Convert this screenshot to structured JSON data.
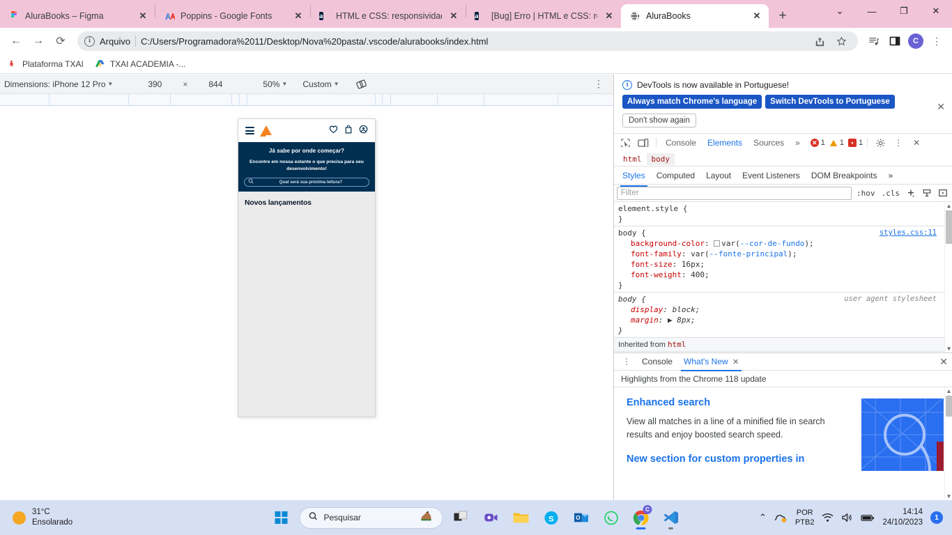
{
  "browser": {
    "tabs": [
      {
        "title": "AluraBooks – Figma",
        "favicon": "figma-icon",
        "active": false
      },
      {
        "title": "Poppins - Google Fonts",
        "favicon": "google-fonts-icon",
        "active": false
      },
      {
        "title": "HTML e CSS: responsividade",
        "favicon": "alura-icon",
        "active": false
      },
      {
        "title": "[Bug] Erro | HTML e CSS: res",
        "favicon": "alura-icon",
        "active": false
      },
      {
        "title": "AluraBooks",
        "favicon": "globe-icon",
        "active": true
      }
    ],
    "new_tab_label": "+",
    "close_label": "✕",
    "window_controls": {
      "search_tabs": "⌄",
      "minimize": "—",
      "maximize": "❐",
      "close": "✕"
    },
    "nav": {
      "back": "←",
      "forward": "→",
      "reload": "⟳"
    },
    "omnibox": {
      "scheme_label": "Arquivo",
      "url": "C:/Users/Programadora%2011/Desktop/Nova%20pasta/.vscode/alurabooks/index.html",
      "share_icon": "share-icon",
      "bookmark_icon": "star-icon"
    },
    "toolbar_icons": [
      "reading-list-icon",
      "side-panel-icon"
    ],
    "profile_initial": "C",
    "menu_icon": "⋮",
    "bookmarks": [
      {
        "label": "Plataforma TXAI",
        "icon": "txai-icon"
      },
      {
        "label": "TXAI ACADEMIA -...",
        "icon": "google-drive-icon"
      }
    ]
  },
  "device_toolbar": {
    "dimensions_label": "Dimensions: iPhone 12 Pro",
    "width": "390",
    "times": "×",
    "height": "844",
    "zoom": "50%",
    "throttling": "Custom",
    "rotate_icon": "rotate-icon",
    "kebab": "⋮"
  },
  "page_preview": {
    "header": {
      "menu_icon": "hamburger-icon",
      "logo": "alura-logo",
      "favorites_icon": "heart-icon",
      "cart_icon": "bag-icon",
      "account_icon": "user-icon"
    },
    "hero": {
      "title": "Já sabe por onde começar?",
      "subtitle": "Encontre em nossa estante o que precisa para seu desenvolvimento!",
      "search_placeholder": "Qual será sua próxima leitura?",
      "search_icon": "search-icon",
      "bg_color": "#002f52"
    },
    "section_title": "Novos lançamentos"
  },
  "devtools": {
    "notice": {
      "message": "DevTools is now available in Portuguese!",
      "info_icon": "info-icon",
      "primary_button": "Always match Chrome's language",
      "secondary_button": "Switch DevTools to Portuguese",
      "tertiary_button": "Don't show again",
      "close_icon": "✕"
    },
    "tabs": {
      "inspect_icon": "inspect-icon",
      "device_toggle_icon": "device-toolbar-icon",
      "items": [
        "Console",
        "Elements",
        "Sources"
      ],
      "selected": "Elements",
      "more": "»",
      "errors": "1",
      "warnings": "1",
      "messages": "1",
      "settings_icon": "gear-icon",
      "kebab_icon": "⋮",
      "close_icon": "✕"
    },
    "breadcrumb": [
      "html",
      "body"
    ],
    "breadcrumb_selected": "body",
    "sidebar_tabs": {
      "items": [
        "Styles",
        "Computed",
        "Layout",
        "Event Listeners",
        "DOM Breakpoints"
      ],
      "selected": "Styles",
      "more": "»"
    },
    "filter": {
      "placeholder": "Filter",
      "hov": ":hov",
      "cls": ".cls",
      "new_rule_icon": "plus-icon",
      "class_icon": "element-classes-icon",
      "toggle_icon": "computed-sidebar-icon"
    },
    "styles_rules": [
      {
        "selector": "element.style {",
        "source": "",
        "declarations": [],
        "close": "}"
      },
      {
        "selector": "body {",
        "source": "styles.css:11",
        "declarations": [
          {
            "property": "background-color",
            "value": "var(--cor-de-fundo);",
            "swatch": true,
            "var": "--cor-de-fundo"
          },
          {
            "property": "font-family",
            "value": "var(--fonte-principal);",
            "swatch": false,
            "var": "--fonte-principal"
          },
          {
            "property": "font-size",
            "value": "16px;",
            "swatch": false
          },
          {
            "property": "font-weight",
            "value": "400;",
            "swatch": false
          }
        ],
        "close": "}"
      },
      {
        "selector": "body {",
        "source": "user agent stylesheet",
        "ua": true,
        "declarations": [
          {
            "property": "display",
            "value": "block;",
            "swatch": false
          },
          {
            "property": "margin",
            "value": "▶ 8px;",
            "swatch": false
          }
        ],
        "close": "}"
      }
    ],
    "inherited_label": "Inherited from",
    "inherited_from": "html",
    "drawer": {
      "kebab": "⋮",
      "tabs": [
        "Console",
        "What's New"
      ],
      "selected": "What's New",
      "tab_close": "✕",
      "close_icon": "✕",
      "subtitle": "Highlights from the Chrome 118 update",
      "items": [
        {
          "title": "Enhanced search",
          "body": "View all matches in a line of a minified file in search results and enjoy boosted search speed."
        },
        {
          "title": "New section for custom properties in",
          "body": ""
        }
      ]
    }
  },
  "taskbar": {
    "weather": {
      "temperature": "31°C",
      "condition": "Ensolarado",
      "icon": "sun-icon"
    },
    "start_icon": "windows-start-icon",
    "search_placeholder": "Pesquisar",
    "search_icon": "search-icon",
    "search_mascot": "horse-icon",
    "apps": [
      {
        "name": "task-view-icon"
      },
      {
        "name": "meet-icon"
      },
      {
        "name": "file-explorer-icon"
      },
      {
        "name": "skype-icon"
      },
      {
        "name": "outlook-icon"
      },
      {
        "name": "whatsapp-icon"
      },
      {
        "name": "chrome-icon"
      },
      {
        "name": "vscode-icon"
      }
    ],
    "tray": {
      "overflow": "⌃",
      "sync_icon": "onedrive-sync-icon",
      "language": "POR",
      "keyboard": "PTB2",
      "wifi_icon": "wifi-icon",
      "volume_icon": "volume-icon",
      "battery_icon": "battery-icon",
      "time": "14:14",
      "date": "24/10/2023",
      "notification_count": "1"
    }
  }
}
